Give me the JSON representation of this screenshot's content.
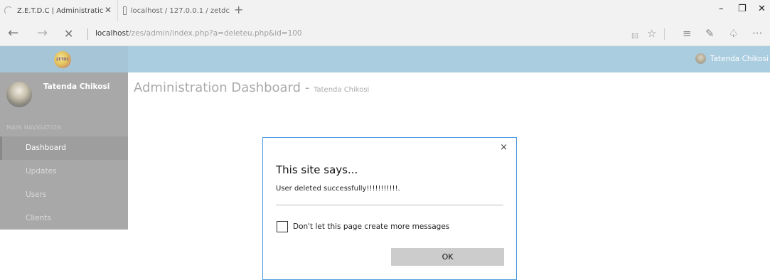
{
  "browser": {
    "tabs": [
      {
        "title": "Z.E.T.D.C | Administratic",
        "close": "✕"
      },
      {
        "title": "localhost / 127.0.0.1 / zetdc"
      }
    ],
    "new_tab": "+",
    "window": {
      "minimize": "–",
      "maximize": "❐",
      "close": "✕"
    },
    "nav": {
      "back": "←",
      "forward": "→",
      "stop": "✕"
    },
    "url_host": "localhost",
    "url_path": "/zes/admin/index.php?a=deleteu.php&id=100",
    "tools": {
      "reading": "▯▯",
      "favorite": "☆",
      "hub": "≡",
      "note": "✎",
      "share": "♤",
      "more": "···"
    }
  },
  "header": {
    "logo_text": "ZETDC",
    "user_name": "Tatenda Chikosi"
  },
  "sidebar": {
    "profile_name": "Tatenda Chikosi",
    "nav_header": "MAIN NAVIGATION",
    "items": [
      {
        "label": "Dashboard"
      },
      {
        "label": "Updates"
      },
      {
        "label": "Users"
      },
      {
        "label": "Clients"
      }
    ]
  },
  "main": {
    "title": "Administration Dashboard",
    "title_sep": " - ",
    "subtitle": "Tatenda Chikosi"
  },
  "dialog": {
    "close": "×",
    "title": "This site says...",
    "message": "User deleted successfully!!!!!!!!!!!.",
    "checkbox_label": "Don't let this page create more messages",
    "checked": false,
    "ok_label": "OK"
  }
}
